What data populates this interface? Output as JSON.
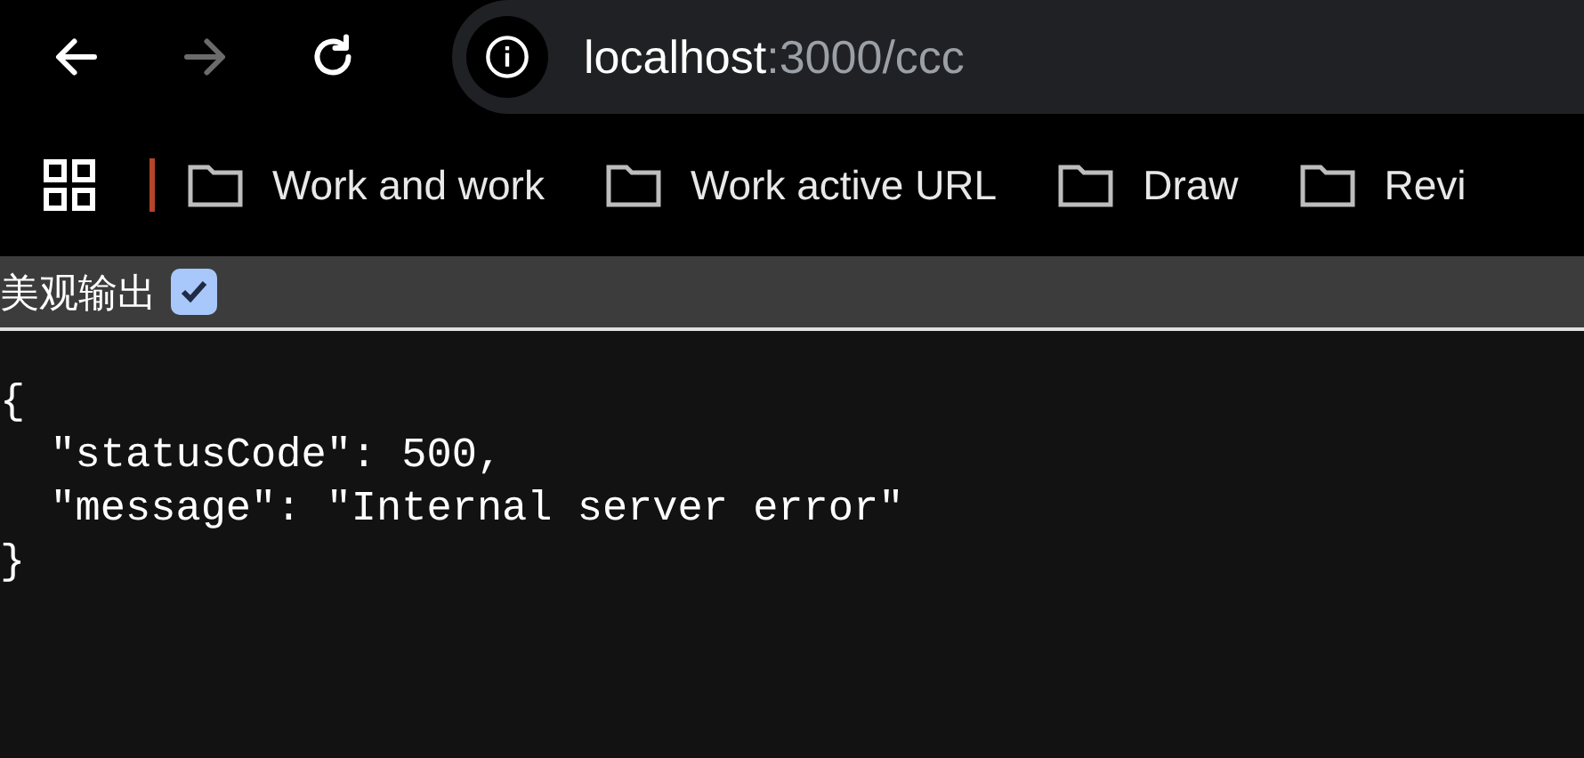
{
  "nav_buttons": [
    {
      "kind": "back",
      "disabled": false
    },
    {
      "kind": "forward",
      "disabled": true
    },
    {
      "kind": "reload",
      "disabled": false
    }
  ],
  "address_bar": {
    "host": "localhost",
    "path": ":3000/ccc"
  },
  "bookmarks": [
    "Work and work",
    "Work active URL",
    "Draw",
    "Revi"
  ],
  "pretty_print": {
    "label": "美观输出",
    "checked": true
  },
  "body": "{\n  \"statusCode\": 500,\n  \"message\": \"Internal server error\"\n}"
}
